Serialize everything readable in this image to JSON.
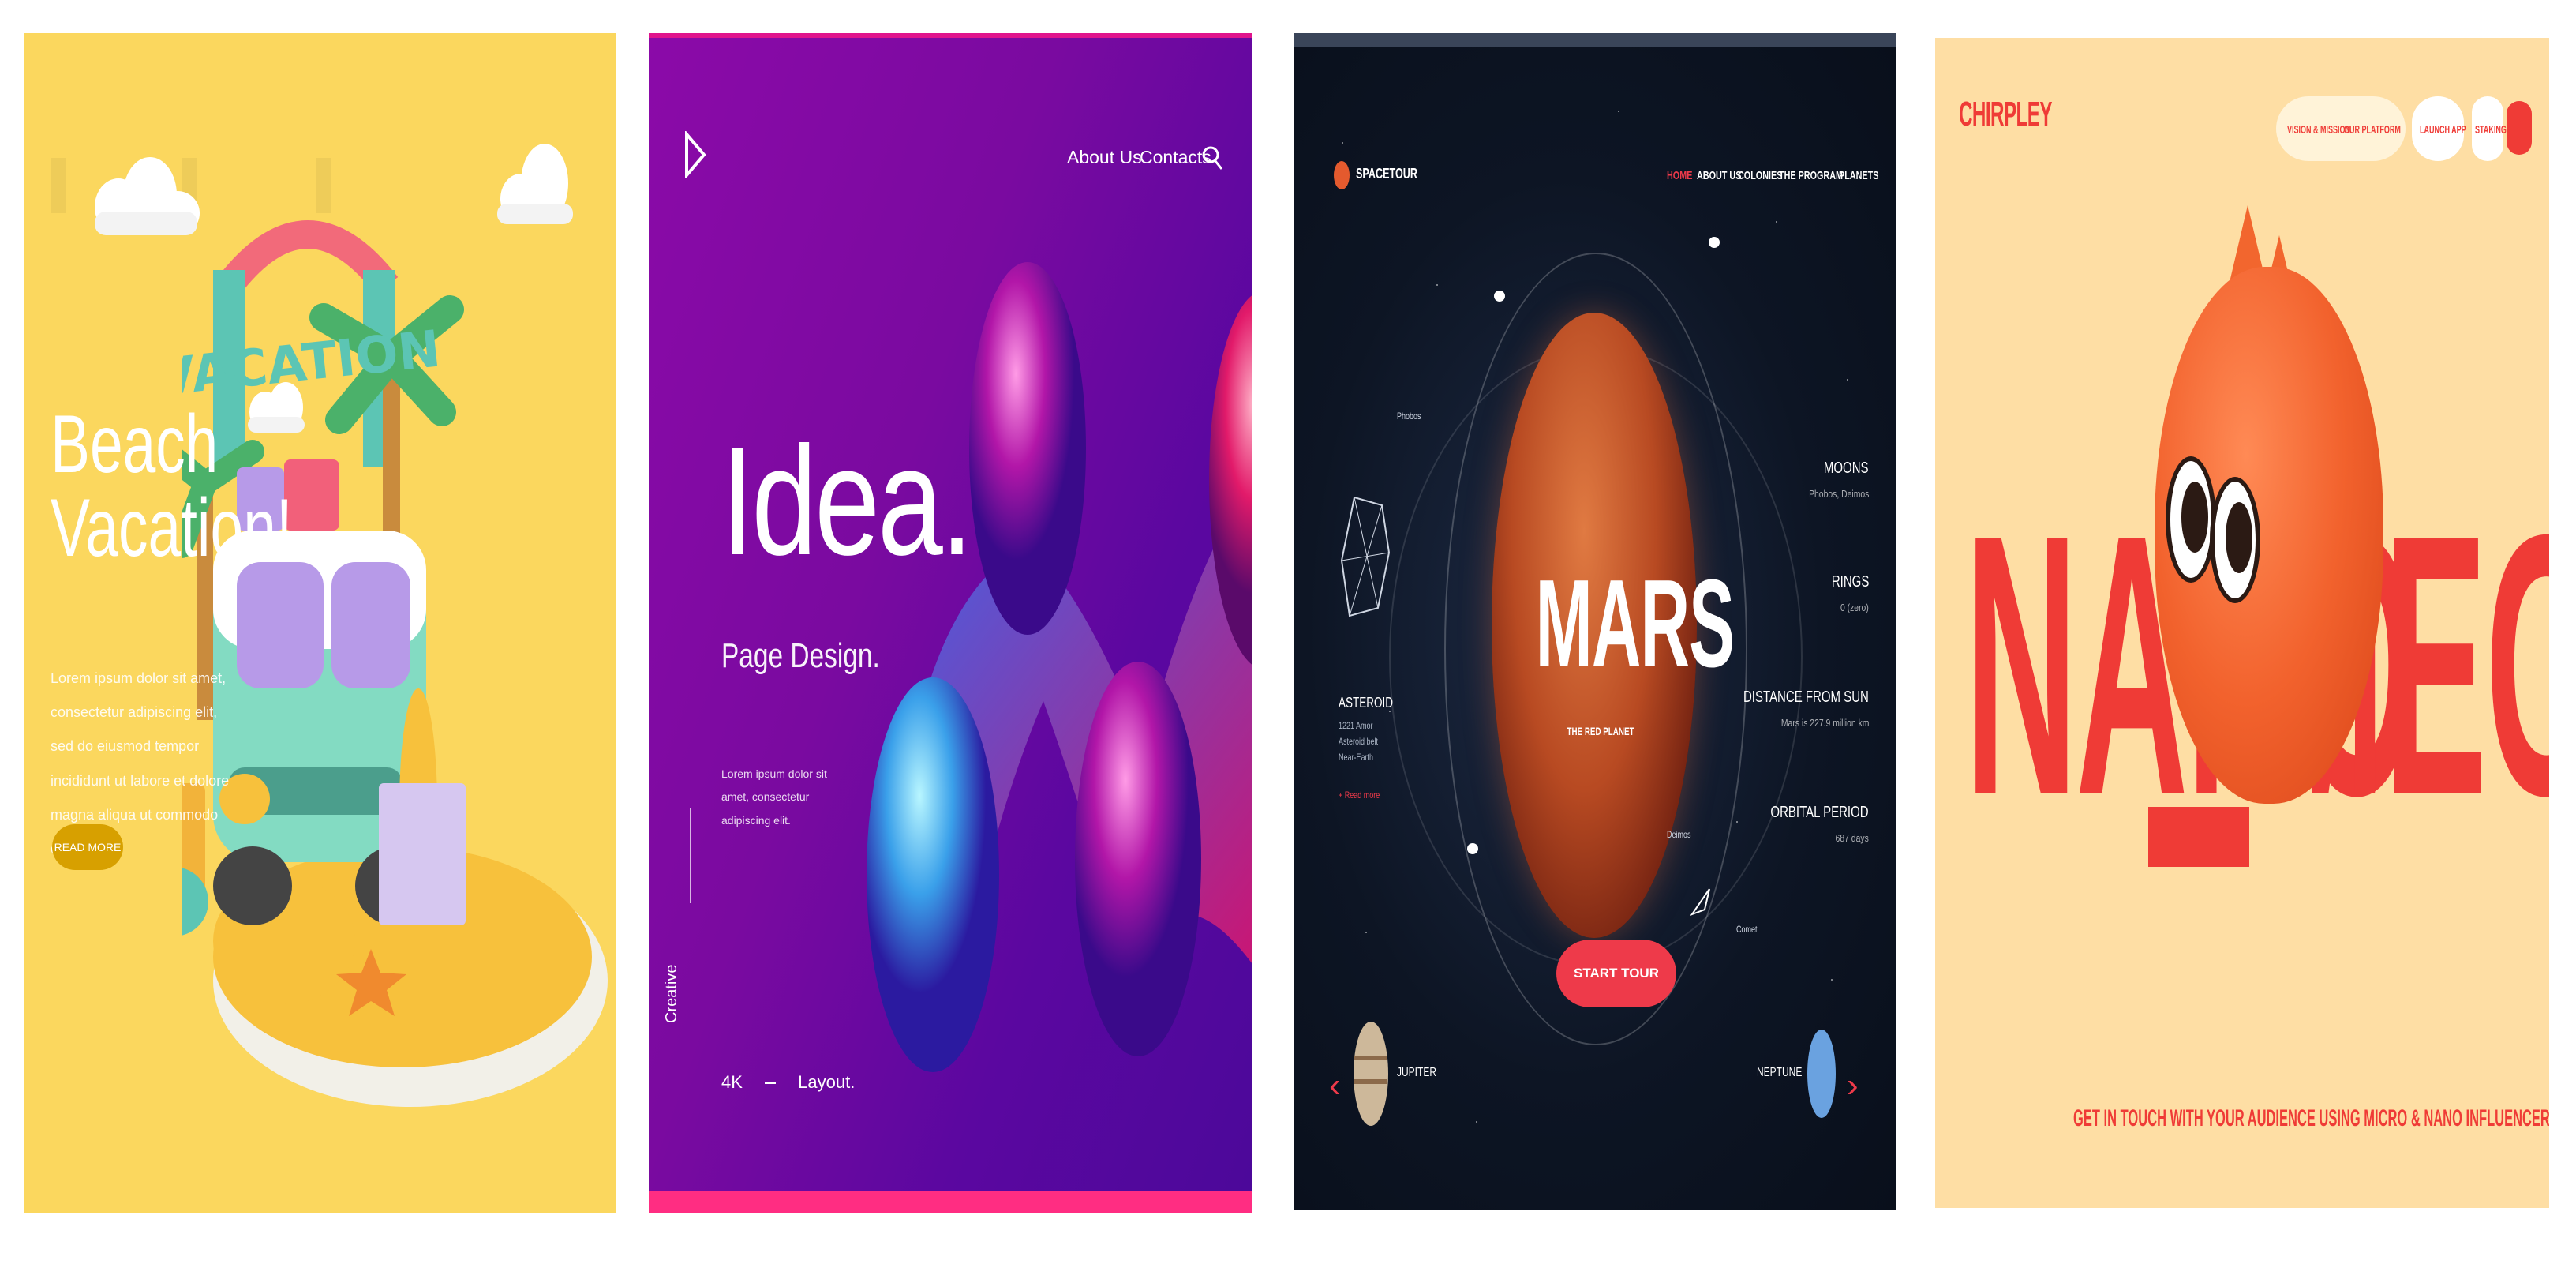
{
  "panel_beach": {
    "headline": "Beach\nVacation!",
    "body": "Lorem ipsum dolor sit amet, consectetur adipiscing elit, sed do eiusmod tempor incididunt ut labore et dolore magna aliqua ut commodo consequat.",
    "button_label": "READ MORE",
    "sign_text": "VACATION",
    "colors": {
      "background": "#fbd75e",
      "button": "#d7a000"
    }
  },
  "panel_idea": {
    "nav": {
      "about": "About Us",
      "contacts": "Contacts"
    },
    "headline": "Idea.",
    "subheadline": "Page Design.",
    "body": "Lorem ipsum dolor sit amet, consectetur adipiscing elit.",
    "vertical_text": "Creative",
    "footer_left": "4K",
    "footer_right": "Layout.",
    "colors": {
      "bg_start": "#8b0aa8",
      "bg_end": "#4c089a",
      "accent": "#ff2d82"
    }
  },
  "panel_space": {
    "brand": "SPACETOUR",
    "nav": [
      "HOME",
      "ABOUT US",
      "COLONIES",
      "THE PROGRAM",
      "PLANETS"
    ],
    "planet_name": "MARS",
    "tagline": "THE RED PLANET",
    "cta_label": "START TOUR",
    "stats": [
      {
        "label": "MOONS",
        "value": "Phobos, Deimos"
      },
      {
        "label": "RINGS",
        "value": "0 (zero)"
      },
      {
        "label": "DISTANCE FROM SUN",
        "value": "Mars is 227.9 million km"
      },
      {
        "label": "ORBITAL PERIOD",
        "value": "687 days"
      }
    ],
    "left_info": {
      "title": "ASTEROID",
      "lines": [
        "1221 Amor",
        "Asteroid belt",
        "Near-Earth"
      ],
      "link": "+ Read more"
    },
    "bottom_left": "JUPITER",
    "bottom_right": "NEPTUNE",
    "small_labels": [
      "Phobos",
      "Deimos",
      "Comet"
    ],
    "colors": {
      "background": "#0d1524",
      "accent": "#ee3a4a",
      "planet": "#b84a22"
    }
  },
  "panel_nano": {
    "logo": "CHIRPLEY",
    "nav": {
      "vision": "VISION & MISSION",
      "platform": "OUR PLATFORM",
      "launch": "LAUNCH APP",
      "staking": "STAKING"
    },
    "headline_left": "NANO",
    "headline_right": "MEGA",
    "bottom_text": "GET IN TOUCH WITH YOUR AUDIENCE USING MICRO & NANO INFLUENCERS",
    "colors": {
      "background": "#fedea4",
      "accent": "#ef3b36",
      "creature": "#f2622d"
    }
  }
}
